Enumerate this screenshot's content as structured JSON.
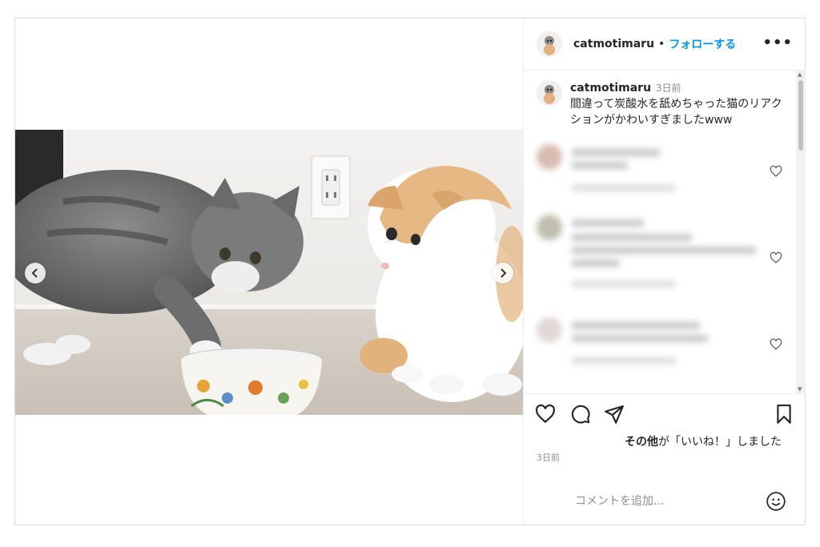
{
  "post": {
    "username": "catmotimaru",
    "separator": "•",
    "follow_label": "フォローする",
    "more_label": "•••"
  },
  "caption": {
    "username": "catmotimaru",
    "time": "3日前",
    "text": "間違って炭酸水を舐めちゃった猫のリアクションがかわいすぎましたwww"
  },
  "likes": {
    "bold": "その他",
    "rest": "が「いいね！」しました"
  },
  "posted_time": "3日前",
  "add_comment": {
    "placeholder": "コメントを追加..."
  },
  "icons": {
    "like": "heart-icon",
    "comment": "comment-icon",
    "share": "paper-plane-icon",
    "save": "bookmark-icon",
    "emoji": "emoji-icon",
    "more": "more-options-icon",
    "prev": "chevron-left-icon",
    "next": "chevron-right-icon"
  },
  "colors": {
    "follow": "#0095f6",
    "muted": "#8e8e8e",
    "border": "#dbdbdb"
  }
}
